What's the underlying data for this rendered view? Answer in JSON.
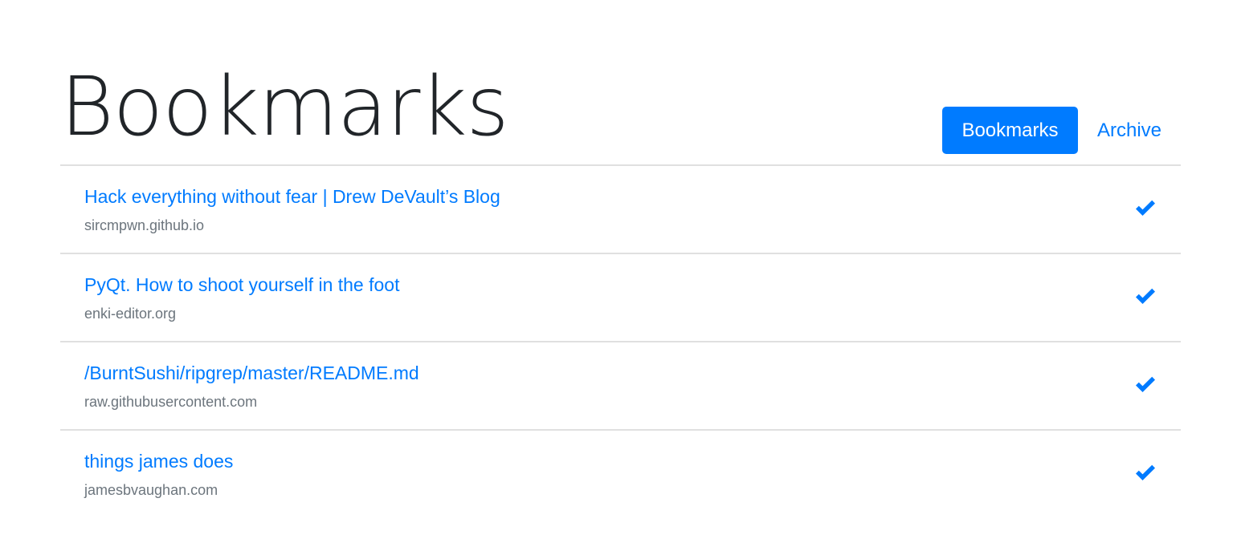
{
  "header": {
    "title": "Bookmarks",
    "nav": [
      {
        "label": "Bookmarks",
        "active": true
      },
      {
        "label": "Archive",
        "active": false
      }
    ]
  },
  "bookmarks": [
    {
      "title": "Hack everything without fear | Drew DeVault’s Blog",
      "domain": "sircmpwn.github.io",
      "action_icon": "check-icon"
    },
    {
      "title": "PyQt. How to shoot yourself in the foot",
      "domain": "enki-editor.org",
      "action_icon": "check-icon"
    },
    {
      "title": "/BurntSushi/ripgrep/master/README.md",
      "domain": "raw.githubusercontent.com",
      "action_icon": "check-icon"
    },
    {
      "title": "things james does",
      "domain": "jamesbvaughan.com",
      "action_icon": "check-icon"
    }
  ],
  "colors": {
    "accent": "#007bff",
    "text": "#212529",
    "muted": "#6c757d",
    "divider": "#e0e0e0"
  }
}
